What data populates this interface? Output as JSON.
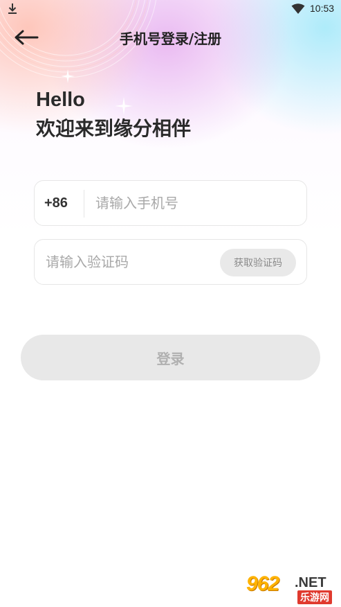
{
  "status_bar": {
    "time": "10:53",
    "icons": [
      "download-icon",
      "wifi-icon"
    ]
  },
  "nav": {
    "back_icon": "arrow-left-icon",
    "title": "手机号登录/注册"
  },
  "greeting": {
    "hello": "Hello",
    "welcome": "欢迎来到缘分相伴"
  },
  "phone_field": {
    "prefix": "+86",
    "value": "",
    "placeholder": "请输入手机号"
  },
  "code_field": {
    "value": "",
    "placeholder": "请输入验证码",
    "button_label": "获取验证码"
  },
  "login_button": {
    "label": "登录"
  },
  "watermark": {
    "number": "962",
    "suffix": ".NET",
    "label": "乐游网"
  },
  "colors": {
    "input_border": "#e6e6e6",
    "button_disabled_bg": "#e8e8e8",
    "button_disabled_text": "#b0b0b0",
    "placeholder": "#a8a8a8"
  }
}
